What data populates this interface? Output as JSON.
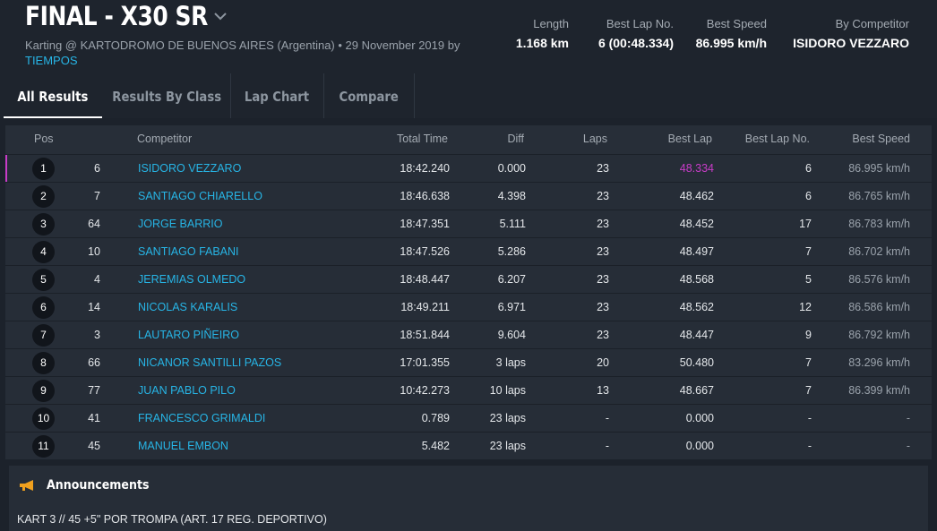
{
  "header": {
    "title": "FINAL - X30 SR",
    "subtitle": "Karting @ KARTODROMO DE BUENOS AIRES (Argentina) • 29 November 2019 by",
    "link": "TIEMPOS",
    "stats": [
      {
        "label": "Length",
        "value": "1.168 km"
      },
      {
        "label": "Best Lap No.",
        "value": "6 (00:48.334)"
      },
      {
        "label": "Best Speed",
        "value": "86.995 km/h"
      },
      {
        "label": "By Competitor",
        "value": "ISIDORO VEZZARO"
      }
    ]
  },
  "tabs": [
    "All Results",
    "Results By Class",
    "Lap Chart",
    "Compare"
  ],
  "table": {
    "columns": [
      "Pos",
      "Competitor",
      "Total Time",
      "Diff",
      "Laps",
      "Best Lap",
      "Best Lap No.",
      "Best Speed"
    ],
    "rows": [
      {
        "pos": "1",
        "no": "6",
        "name": "ISIDORO VEZZARO",
        "total": "18:42.240",
        "diff": "0.000",
        "laps": "23",
        "best": "48.334",
        "bestno": "6",
        "speed": "86.995 km/h"
      },
      {
        "pos": "2",
        "no": "7",
        "name": "SANTIAGO CHIARELLO",
        "total": "18:46.638",
        "diff": "4.398",
        "laps": "23",
        "best": "48.462",
        "bestno": "6",
        "speed": "86.765 km/h"
      },
      {
        "pos": "3",
        "no": "64",
        "name": "JORGE BARRIO",
        "total": "18:47.351",
        "diff": "5.111",
        "laps": "23",
        "best": "48.452",
        "bestno": "17",
        "speed": "86.783 km/h"
      },
      {
        "pos": "4",
        "no": "10",
        "name": "SANTIAGO FABANI",
        "total": "18:47.526",
        "diff": "5.286",
        "laps": "23",
        "best": "48.497",
        "bestno": "7",
        "speed": "86.702 km/h"
      },
      {
        "pos": "5",
        "no": "4",
        "name": "JEREMIAS OLMEDO",
        "total": "18:48.447",
        "diff": "6.207",
        "laps": "23",
        "best": "48.568",
        "bestno": "5",
        "speed": "86.576 km/h"
      },
      {
        "pos": "6",
        "no": "14",
        "name": "NICOLAS KARALIS",
        "total": "18:49.211",
        "diff": "6.971",
        "laps": "23",
        "best": "48.562",
        "bestno": "12",
        "speed": "86.586 km/h"
      },
      {
        "pos": "7",
        "no": "3",
        "name": "LAUTARO PIÑEIRO",
        "total": "18:51.844",
        "diff": "9.604",
        "laps": "23",
        "best": "48.447",
        "bestno": "9",
        "speed": "86.792 km/h"
      },
      {
        "pos": "8",
        "no": "66",
        "name": "NICANOR SANTILLI PAZOS",
        "total": "17:01.355",
        "diff": "3 laps",
        "laps": "20",
        "best": "50.480",
        "bestno": "7",
        "speed": "83.296 km/h"
      },
      {
        "pos": "9",
        "no": "77",
        "name": "JUAN PABLO PILO",
        "total": "10:42.273",
        "diff": "10 laps",
        "laps": "13",
        "best": "48.667",
        "bestno": "7",
        "speed": "86.399 km/h"
      },
      {
        "pos": "10",
        "no": "41",
        "name": "FRANCESCO GRIMALDI",
        "total": "0.789",
        "diff": "23 laps",
        "laps": "-",
        "best": "0.000",
        "bestno": "-",
        "speed": "-"
      },
      {
        "pos": "11",
        "no": "45",
        "name": "MANUEL EMBON",
        "total": "5.482",
        "diff": "23 laps",
        "laps": "-",
        "best": "0.000",
        "bestno": "-",
        "speed": "-"
      }
    ]
  },
  "announcements": {
    "title": "Announcements",
    "text": "KART 3 // 45 +5\" POR TROMPA (ART. 17 REG. DEPORTIVO)"
  },
  "colors": {
    "accent": "#27b5e6",
    "best_lap_highlight": "#c83cc8",
    "background": "#1c222b"
  }
}
